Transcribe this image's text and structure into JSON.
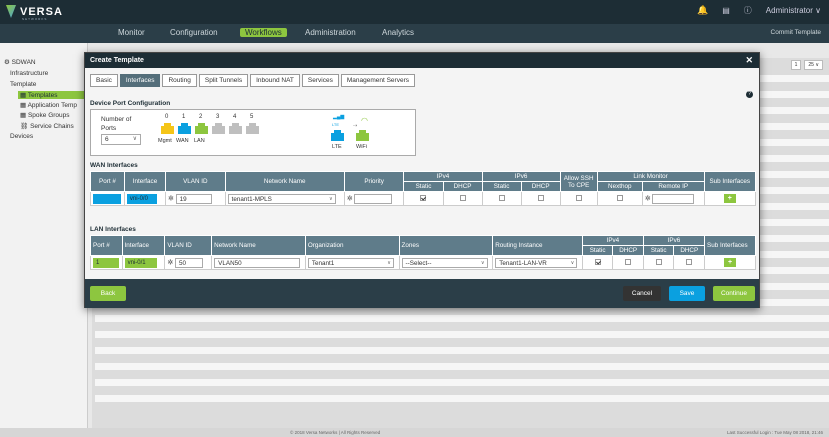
{
  "app": {
    "brand": "VERSA",
    "brand_sub": "NETWORKS",
    "user": "Administrator ∨",
    "commit": "Commit Template"
  },
  "nav": [
    "Monitor",
    "Configuration",
    "Workflows",
    "Administration",
    "Analytics"
  ],
  "nav_active": "Workflows",
  "sidebar": {
    "items": [
      "SDWAN",
      "Infrastructure",
      "Template",
      "Templates",
      "Application Temp",
      "Spoke Groups",
      "Service Chains",
      "Devices"
    ]
  },
  "pager": {
    "page": "1",
    "size": "25 ∨"
  },
  "footer": {
    "copyright": "© 2018 Versa Networks | All Rights Reserved",
    "login": "Last Successful Login : Tue May 08 2018, 21:46"
  },
  "modal": {
    "title": "Create Template",
    "tabs": [
      "Basic",
      "Interfaces",
      "Routing",
      "Split Tunnels",
      "Inbound NAT",
      "Services",
      "Management Servers"
    ],
    "active_tab": "Interfaces",
    "dpc": {
      "title": "Device Port Configuration",
      "num_ports_label": "Number of Ports",
      "num_ports": "6",
      "port_numbers": [
        "0",
        "1",
        "2",
        "3",
        "4",
        "5"
      ],
      "port_labels": [
        "Mgmt",
        "WAN",
        "LAN"
      ],
      "lte": "LTE",
      "wifi": "WiFi"
    },
    "wan": {
      "title": "WAN Interfaces",
      "headers": [
        "Port #",
        "Interface",
        "VLAN ID",
        "Network Name",
        "Priority",
        "IPv4",
        "IPv6",
        "Allow SSH To CPE",
        "Link Monitor",
        "Sub Interfaces"
      ],
      "subheaders": [
        "Static",
        "DHCP",
        "Static",
        "DHCP",
        "Nexthop",
        "Remote IP"
      ],
      "row": {
        "port": "0",
        "interface": "vni-0/0",
        "vlan": "19",
        "network": "tenant1-MPLS",
        "priority": ""
      }
    },
    "lan": {
      "title": "LAN Interfaces",
      "headers": [
        "Port #",
        "Interface",
        "VLAN ID",
        "Network Name",
        "Organization",
        "Zones",
        "Routing Instance",
        "IPv4",
        "IPv6",
        "Sub Interfaces"
      ],
      "subheaders": [
        "Static",
        "DHCP",
        "Static",
        "DHCP"
      ],
      "row": {
        "port": "1",
        "interface": "vni-0/1",
        "vlan": "50",
        "network": "VLAN50",
        "org": "Tenant1",
        "zones": "--Select--",
        "routing": "Tenant1-LAN-VR"
      }
    },
    "buttons": {
      "back": "Back",
      "cancel": "Cancel",
      "save": "Save",
      "continue": "Continue"
    }
  },
  "colors": {
    "accent": "#8dc63f",
    "header": "#1d2d35",
    "table_header": "#5f7c8a",
    "blue": "#0aa0e0"
  }
}
